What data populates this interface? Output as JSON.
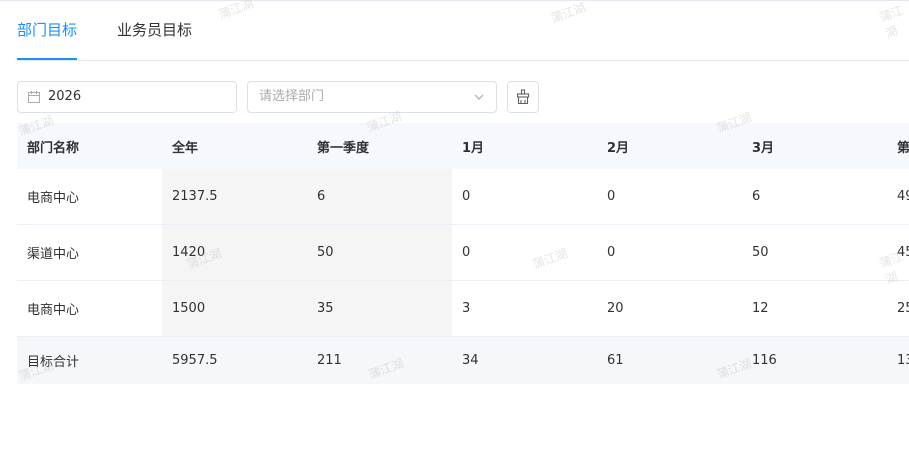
{
  "tabs": [
    {
      "label": "部门目标",
      "active": true
    },
    {
      "label": "业务员目标",
      "active": false
    }
  ],
  "filters": {
    "year": "2026",
    "department_placeholder": "请选择部门"
  },
  "table": {
    "headers": [
      "部门名称",
      "全年",
      "第一季度",
      "1月",
      "2月",
      "3月",
      "第"
    ],
    "rows": [
      [
        "电商中心",
        "2137.5",
        "6",
        "0",
        "0",
        "6",
        "49"
      ],
      [
        "渠道中心",
        "1420",
        "50",
        "0",
        "0",
        "50",
        "45"
      ],
      [
        "电商中心",
        "1500",
        "35",
        "3",
        "20",
        "12",
        "25"
      ]
    ],
    "total": [
      "目标合计",
      "5957.5",
      "211",
      "34",
      "61",
      "116",
      "13"
    ]
  },
  "watermark": "蒲江湖",
  "colors": {
    "accent": "#1890ff",
    "header_bg": "#f5f8fc",
    "shaded_col": "#f5f5f5"
  }
}
